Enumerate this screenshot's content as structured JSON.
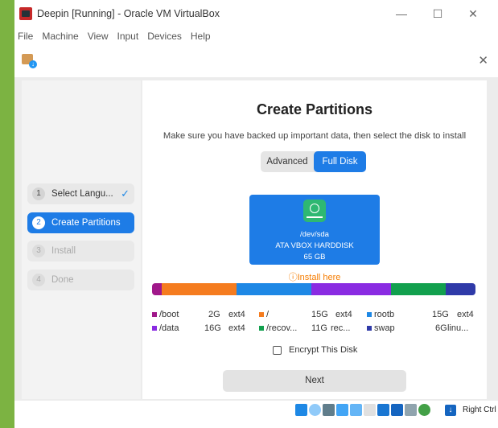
{
  "window": {
    "title": "Deepin [Running] - Oracle VM VirtualBox",
    "controls": {
      "minimize": "—",
      "maximize": "☐",
      "close": "✕"
    }
  },
  "menu": [
    "File",
    "Machine",
    "View",
    "Input",
    "Devices",
    "Help"
  ],
  "installer": {
    "close": "✕",
    "steps": [
      {
        "num": "1",
        "label": "Select Langu...",
        "state": "done",
        "check": "✓"
      },
      {
        "num": "2",
        "label": "Create Partitions",
        "state": "active"
      },
      {
        "num": "3",
        "label": "Install",
        "state": "disabled"
      },
      {
        "num": "4",
        "label": "Done",
        "state": "disabled"
      }
    ],
    "heading": "Create Partitions",
    "subtitle": "Make sure you have backed up important data, then select the disk to install",
    "modes": {
      "advanced": "Advanced",
      "full_disk": "Full Disk",
      "selected": "Full Disk"
    },
    "disk": {
      "device": "/dev/sda",
      "model": "ATA VBOX HARDDISK",
      "size": "65 GB"
    },
    "install_here": "ⓘInstall here",
    "partitions": [
      {
        "name": "/boot",
        "size": "2G",
        "fs": "ext4",
        "color": "#a0188a",
        "share": 2
      },
      {
        "name": "/",
        "size": "15G",
        "fs": "ext4",
        "color": "#f57c1f",
        "share": 15
      },
      {
        "name": "rootb",
        "size": "15G",
        "fs": "ext4",
        "color": "#1e88e5",
        "share": 15
      },
      {
        "name": "/data",
        "size": "16G",
        "fs": "ext4",
        "color": "#8a2be2",
        "share": 16
      },
      {
        "name": "/recov...",
        "size": "11G",
        "fs": "rec...",
        "color": "#12a04e",
        "share": 11
      },
      {
        "name": "swap",
        "size": "6G",
        "fs": "linu...",
        "color": "#2f3aa8",
        "share": 6
      }
    ],
    "encrypt_label": "Encrypt This Disk",
    "encrypt_checked": false,
    "next_label": "Next"
  },
  "statusbar": {
    "icons": [
      "optical-drive-icon",
      "network-icon",
      "usb-icon",
      "shared-folder-icon",
      "display-icon",
      "recording-icon",
      "snapshot-icon",
      "mouse-integration-icon",
      "cpu-icon",
      "vm-state-icon",
      "arrow-down-icon"
    ],
    "host_key": "Right Ctrl"
  }
}
